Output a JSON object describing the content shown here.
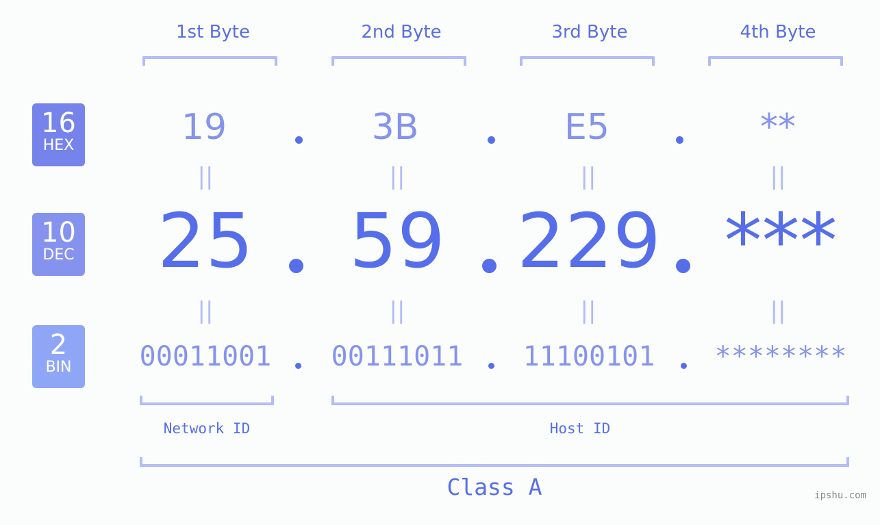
{
  "bytes": [
    {
      "header": "1st Byte",
      "hex": "19",
      "dec": "25",
      "bin": "00011001"
    },
    {
      "header": "2nd Byte",
      "hex": "3B",
      "dec": "59",
      "bin": "00111011"
    },
    {
      "header": "3rd Byte",
      "hex": "E5",
      "dec": "229",
      "bin": "11100101"
    },
    {
      "header": "4th Byte",
      "hex": "**",
      "dec": "***",
      "bin": "********"
    }
  ],
  "badges": {
    "hex": {
      "num": "16",
      "label": "HEX",
      "color": "#7583ea"
    },
    "dec": {
      "num": "10",
      "label": "DEC",
      "color": "#8593ee"
    },
    "bin": {
      "num": "2",
      "label": "BIN",
      "color": "#8fa6f6"
    }
  },
  "equals_glyph": "||",
  "sections": {
    "network_id": "Network ID",
    "host_id": "Host ID",
    "class": "Class A"
  },
  "watermark": "ipshu.com",
  "colors": {
    "primary": "#566eea",
    "secondary": "#8593ec",
    "bracket": "#b3bcf5",
    "background": "#fbfdfc"
  }
}
